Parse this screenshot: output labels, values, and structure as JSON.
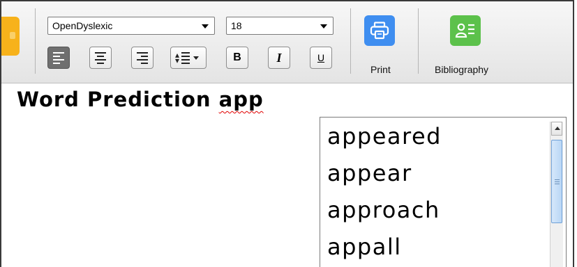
{
  "toolbar": {
    "font_combo": {
      "value": "OpenDyslexic"
    },
    "size_combo": {
      "value": "18"
    },
    "format_buttons": {
      "bold": "B",
      "italic": "I",
      "underline": "U"
    },
    "print": {
      "label": "Print",
      "color": "#3f8ef0",
      "icon": "printer-icon"
    },
    "bibliography": {
      "label": "Bibliography",
      "color": "#5cc14b",
      "icon": "contact-list-icon"
    }
  },
  "document": {
    "text_before": "Word Prediction ",
    "misspelled_word": "app"
  },
  "prediction_popup": {
    "suggestions": [
      "appeared",
      "appear",
      "approach",
      "appall"
    ]
  }
}
